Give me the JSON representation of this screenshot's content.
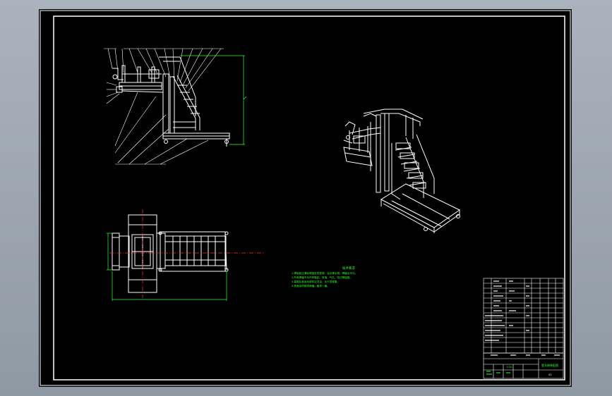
{
  "drawing": {
    "colors": {
      "background": "#000000",
      "line": "#ffffff",
      "dimension": "#33ff33",
      "center_line": "#ff3333",
      "frame": "#ffffff"
    },
    "notes_title": "技术要求",
    "notes": [
      "1.焊接前应清除焊接处的铁锈、油污等杂物，焊缝应均匀。",
      "2.所有焊缝不允许有裂纹、夹渣、气孔、咬边等缺陷。",
      "3.装配后各运动部件应灵活，无卡滞现象。",
      "4.表面涂防锈漆两遍，面漆一遍。"
    ],
    "title_block": {
      "drawing_name": "登车梯装配图",
      "scale": "1:20",
      "sheet": "01"
    }
  }
}
